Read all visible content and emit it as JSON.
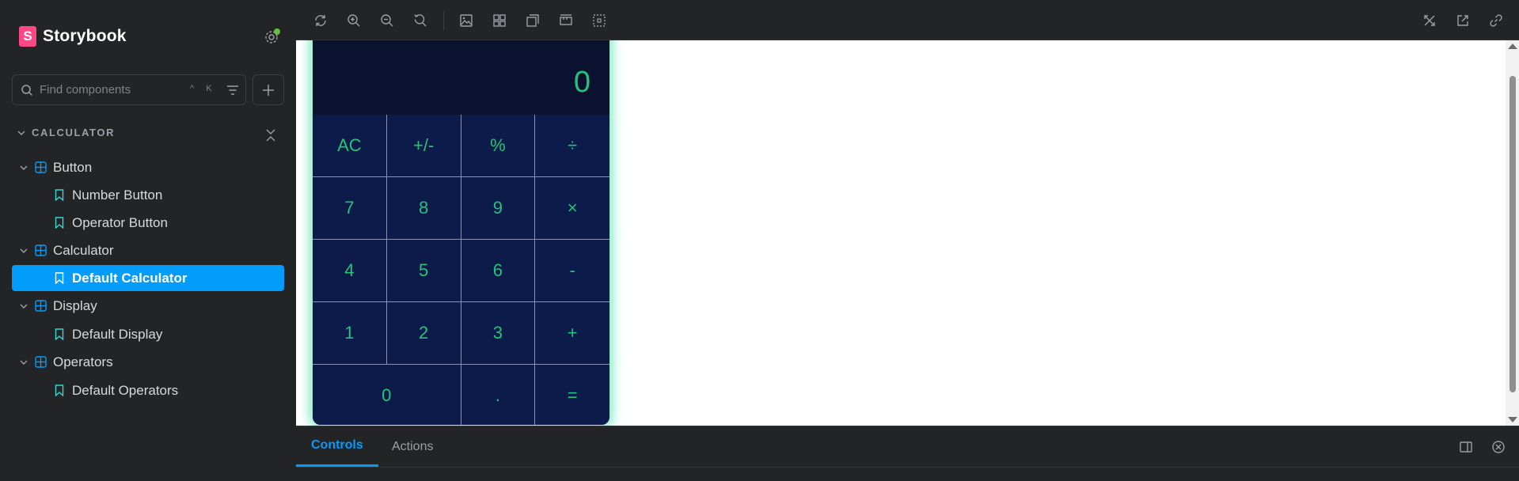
{
  "sidebar": {
    "brand": "Storybook",
    "brand_logo": "S",
    "search_placeholder": "Find components",
    "search_shortcut": "^ K",
    "section_title": "CALCULATOR",
    "tree": [
      {
        "label": "Button",
        "type": "component"
      },
      {
        "label": "Number Button",
        "type": "story"
      },
      {
        "label": "Operator Button",
        "type": "story"
      },
      {
        "label": "Calculator",
        "type": "component"
      },
      {
        "label": "Default Calculator",
        "type": "story",
        "active": true
      },
      {
        "label": "Display",
        "type": "component"
      },
      {
        "label": "Default Display",
        "type": "story"
      },
      {
        "label": "Operators",
        "type": "component"
      },
      {
        "label": "Default Operators",
        "type": "story"
      }
    ]
  },
  "toolbar": {
    "icons": [
      "reload-icon",
      "zoom-in-icon",
      "zoom-out-icon",
      "zoom-reset-icon",
      "background-icon",
      "grid-icon",
      "viewport-icon",
      "measure-icon",
      "outline-icon",
      "fullscreen-icon",
      "open-new-tab-icon",
      "copy-link-icon"
    ]
  },
  "calculator": {
    "display": "0",
    "keys": [
      "AC",
      "+/-",
      "%",
      "÷",
      "7",
      "8",
      "9",
      "×",
      "4",
      "5",
      "6",
      "-",
      "1",
      "2",
      "3",
      "+",
      "0",
      ".",
      "="
    ]
  },
  "addons": {
    "tabs": [
      "Controls",
      "Actions"
    ]
  },
  "colors": {
    "accent": "#029cfd",
    "calc_bg": "#0d1b4a",
    "calc_text": "#22c47a",
    "brand_pink": "#ff4785"
  }
}
